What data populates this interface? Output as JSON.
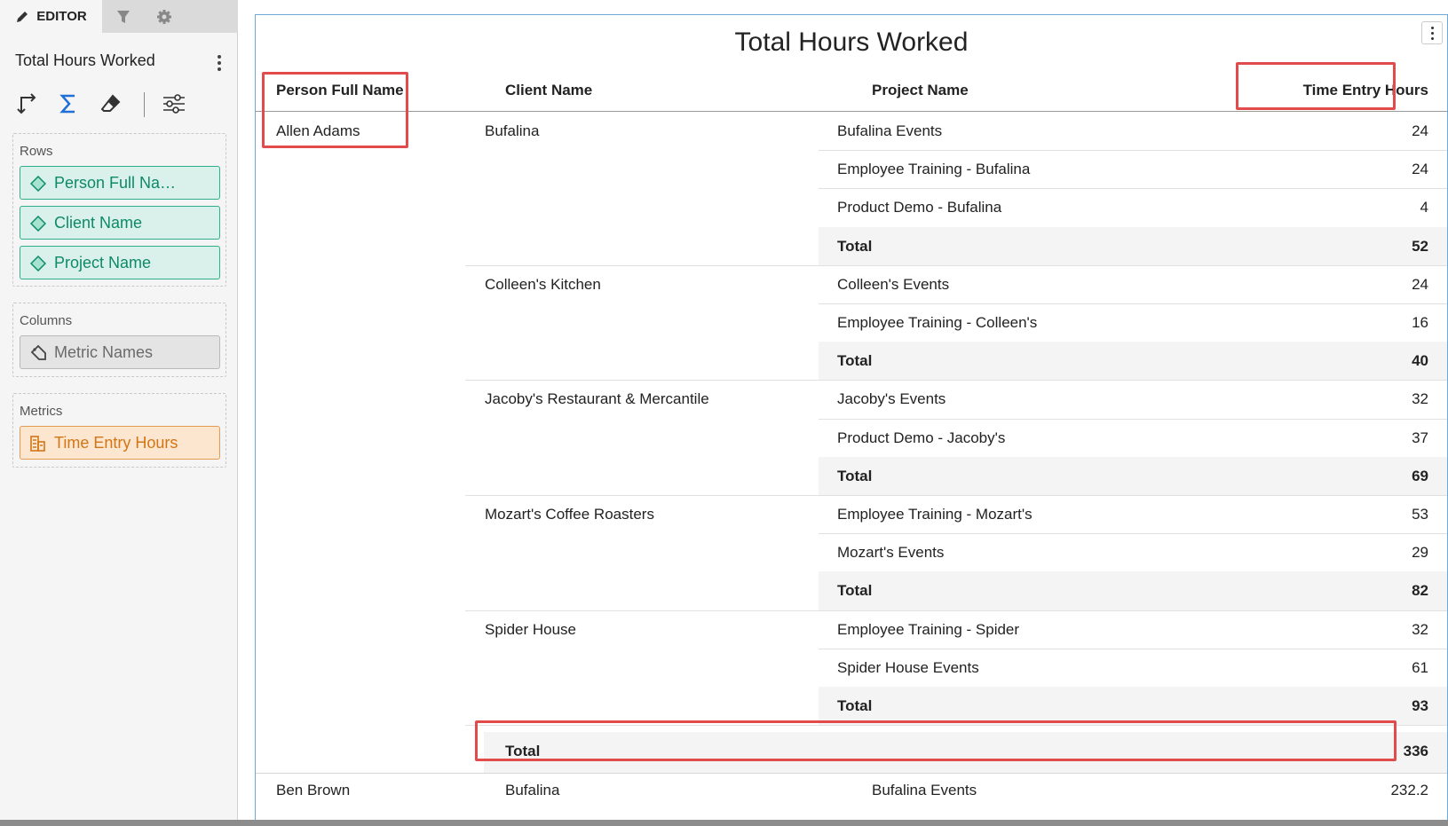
{
  "editor": {
    "tabs": {
      "editor_label": "EDITOR"
    },
    "title": "Total Hours Worked",
    "rows_label": "Rows",
    "rows": [
      "Person Full Na…",
      "Client Name",
      "Project Name"
    ],
    "columns_label": "Columns",
    "columns": [
      "Metric Names"
    ],
    "metrics_label": "Metrics",
    "metrics": [
      "Time Entry Hours"
    ]
  },
  "report": {
    "title": "Total Hours Worked",
    "headers": {
      "person": "Person Full Name",
      "client": "Client Name",
      "project": "Project Name",
      "hours": "Time Entry Hours"
    },
    "person": "Allen Adams",
    "clients": [
      "Bufalina",
      "Colleen's Kitchen",
      "Jacoby's Restaurant & Mercantile",
      "Mozart's Coffee Roasters",
      "Spider House"
    ],
    "rows": [
      {
        "project": "Bufalina Events",
        "hours": "24"
      },
      {
        "project": "Employee Training - Bufalina",
        "hours": "24"
      },
      {
        "project": "Product Demo - Bufalina",
        "hours": "4"
      },
      {
        "project": "Total",
        "hours": "52"
      },
      {
        "project": "Colleen's Events",
        "hours": "24"
      },
      {
        "project": "Employee Training - Colleen's",
        "hours": "16"
      },
      {
        "project": "Total",
        "hours": "40"
      },
      {
        "project": "Jacoby's Events",
        "hours": "32"
      },
      {
        "project": "Product Demo - Jacoby's",
        "hours": "37"
      },
      {
        "project": "Total",
        "hours": "69"
      },
      {
        "project": "Employee Training - Mozart's",
        "hours": "53"
      },
      {
        "project": "Mozart's Events",
        "hours": "29"
      },
      {
        "project": "Total",
        "hours": "82"
      },
      {
        "project": "Employee Training - Spider",
        "hours": "32"
      },
      {
        "project": "Spider House Events",
        "hours": "61"
      },
      {
        "project": "Total",
        "hours": "93"
      }
    ],
    "person_total": {
      "label": "Total",
      "hours": "336"
    },
    "next": {
      "person": "Ben Brown",
      "client": "Bufalina",
      "project": "Bufalina Events",
      "hours": "232.2"
    }
  },
  "colors": {
    "dimension_pill": "#2eae8a",
    "metric_pill": "#e59a52",
    "highlight": "#e14b4b",
    "sum_icon": "#1f6fd6"
  },
  "icons": [
    "pencil-icon",
    "filter-icon",
    "gear-icon",
    "swap-axes-icon",
    "sum-icon",
    "eraser-icon",
    "sliders-icon",
    "diamond-icon",
    "tag-icon",
    "metric-icon"
  ]
}
